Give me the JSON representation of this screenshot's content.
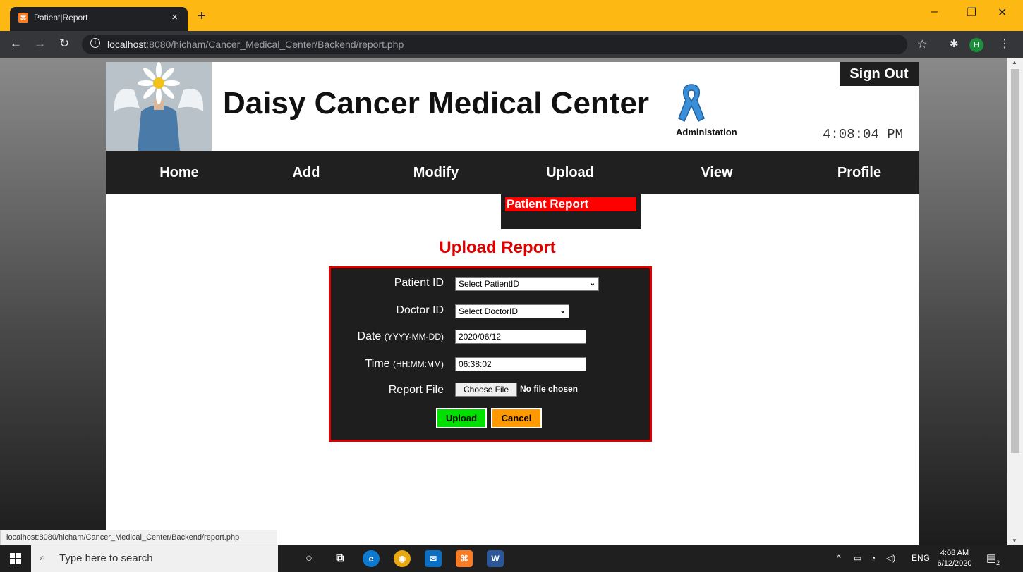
{
  "browser": {
    "tab_title": "Patient|Report",
    "url_host": "localhost",
    "url_rest": ":8080/hicham/Cancer_Medical_Center/Backend/report.php",
    "profile_initial": "H"
  },
  "header": {
    "site_title": "Daisy Cancer Medical Center",
    "subtitle": "Administation",
    "sign_out": "Sign Out",
    "clock": "4:08:04 PM"
  },
  "nav": {
    "items": [
      "Home",
      "Add",
      "Modify",
      "Upload",
      "View",
      "Profile"
    ],
    "dropdown_item": "Patient Report"
  },
  "form": {
    "title": "Upload Report",
    "patient_label": "Patient ID",
    "patient_value": "Select PatientID",
    "doctor_label": "Doctor ID",
    "doctor_value": "Select DoctorID",
    "date_label": "Date",
    "date_hint": "(YYYY-MM-DD)",
    "date_value": "2020/06/12",
    "time_label": "Time",
    "time_hint": "(HH:MM:MM)",
    "time_value": "06:38:02",
    "file_label": "Report File",
    "file_button": "Choose File",
    "file_status": "No file chosen",
    "upload_label": "Upload",
    "cancel_label": "Cancel"
  },
  "status_bar": "localhost:8080/hicham/Cancer_Medical_Center/Backend/report.php",
  "taskbar": {
    "search_placeholder": "Type here to search",
    "lang": "ENG",
    "time": "4:08 AM",
    "date": "6/12/2020",
    "notifications": "2"
  },
  "colors": {
    "accent_red": "#e00000",
    "upload_green": "#00e000",
    "cancel_orange": "#ff9900",
    "tabbar_yellow": "#fdb813",
    "ribbon_blue": "#3a8fd8"
  }
}
